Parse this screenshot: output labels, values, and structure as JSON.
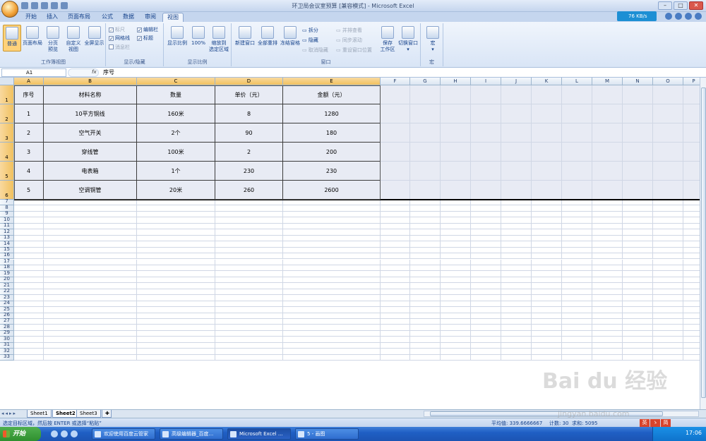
{
  "window": {
    "title": "环卫局会议室预算 [兼容模式] - Microsoft Excel"
  },
  "net_speed": "76 KB/s",
  "tabs": [
    "开始",
    "插入",
    "页面布局",
    "公式",
    "数据",
    "审阅",
    "视图"
  ],
  "active_tab": "视图",
  "ribbon": {
    "workbook_views": {
      "label": "工作簿视图",
      "normal": "普通",
      "page_layout": "页面布局",
      "page_break_1": "分页",
      "page_break_2": "预览",
      "custom_1": "自定义",
      "custom_2": "视图",
      "fullscreen": "全屏显示"
    },
    "show_hide": {
      "label": "显示/隐藏",
      "ruler": "标尺",
      "gridlines": "网格线",
      "message_bar": "消息栏",
      "formula_bar": "编辑栏",
      "headings": "标题"
    },
    "zoom": {
      "label": "显示比例",
      "zoom": "显示比例",
      "zoom100": "100%",
      "zoom_sel_1": "缩放到",
      "zoom_sel_2": "选定区域"
    },
    "window": {
      "label": "窗口",
      "new_window": "新建窗口",
      "arrange_all": "全部重排",
      "freeze": "冻结窗格",
      "split": "拆分",
      "hide": "隐藏",
      "unhide": "取消隐藏",
      "side_by_side": "并排查看",
      "sync_scroll": "同步滚动",
      "reset_pos": "重设窗口位置",
      "save_ws_1": "保存",
      "save_ws_2": "工作区",
      "switch_1": "切换窗口"
    },
    "macros": {
      "label": "宏",
      "macros": "宏"
    }
  },
  "formula_bar": {
    "name_box": "A1",
    "fx": "fx",
    "value": "序号"
  },
  "columns": [
    "A",
    "B",
    "C",
    "D",
    "E",
    "F",
    "G",
    "H",
    "I",
    "J",
    "K",
    "L",
    "M",
    "N",
    "O",
    "P"
  ],
  "rows": [
    "1",
    "2",
    "3",
    "4",
    "5",
    "6",
    "7",
    "8",
    "9",
    "10",
    "11",
    "12",
    "13",
    "14",
    "15",
    "16",
    "17",
    "18",
    "19",
    "20",
    "21",
    "22",
    "23",
    "24",
    "25",
    "26",
    "27",
    "28",
    "29",
    "30",
    "31",
    "32",
    "33"
  ],
  "table": {
    "headers": [
      "序号",
      "材料名称",
      "数量",
      "单价（元）",
      "金额（元）"
    ],
    "rows": [
      [
        "1",
        "10平方铜线",
        "160米",
        "8",
        "1280"
      ],
      [
        "2",
        "空气开关",
        "2个",
        "90",
        "180"
      ],
      [
        "3",
        "穿线管",
        "100米",
        "2",
        "200"
      ],
      [
        "4",
        "电表箱",
        "1个",
        "230",
        "230"
      ],
      [
        "5",
        "空调铜管",
        "20米",
        "260",
        "2600"
      ]
    ]
  },
  "sheets": [
    "Sheet1",
    "Sheet2",
    "Sheet3"
  ],
  "active_sheet": "Sheet2",
  "status": {
    "message": "选定目标区域，然后按 ENTER 或选择“粘贴”",
    "average": "平均值: 339.6666667",
    "count": "计数: 30",
    "sum": "求和: 5095"
  },
  "ime": [
    "英",
    "ゝ",
    "简"
  ],
  "taskbar": {
    "start": "开始",
    "items": [
      "欢迎使用百度云管家",
      "高级编辑器_百度...",
      "Microsoft Excel ...",
      "5 - 画图"
    ],
    "clock": "17:06"
  },
  "watermark": {
    "main": "Bai du 经验",
    "sub": "jingyan.baidu.com"
  }
}
